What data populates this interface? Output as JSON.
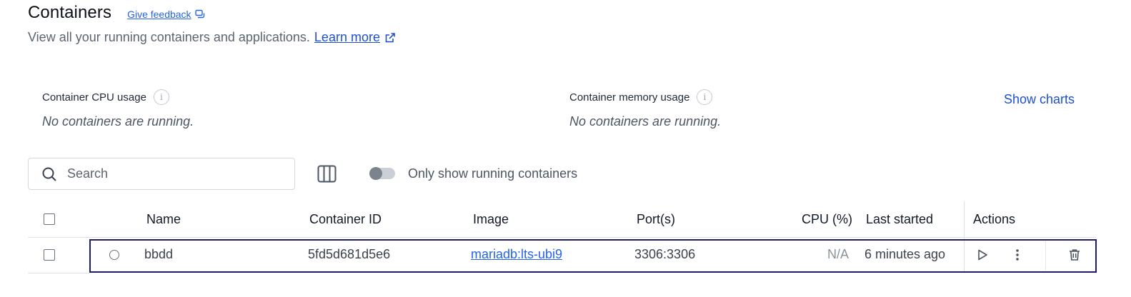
{
  "header": {
    "title": "Containers",
    "feedback_label": "Give feedback",
    "subtitle": "View all your running containers and applications.",
    "learn_more": "Learn more"
  },
  "stats": {
    "cpu_label": "Container CPU usage",
    "cpu_empty": "No containers are running.",
    "memory_label": "Container memory usage",
    "memory_empty": "No containers are running.",
    "show_charts": "Show charts"
  },
  "toolbar": {
    "search_placeholder": "Search",
    "running_toggle_label": "Only show running containers",
    "running_toggle_on": false
  },
  "table": {
    "columns": {
      "name": "Name",
      "container_id": "Container ID",
      "image": "Image",
      "ports": "Port(s)",
      "cpu": "CPU (%)",
      "last_started": "Last started",
      "actions": "Actions"
    },
    "rows": [
      {
        "name": "bbdd",
        "container_id": "5fd5d681d5e6",
        "image": "mariadb:lts-ubi9",
        "ports": "3306:3306",
        "cpu": "N/A",
        "last_started": "6 minutes ago",
        "status": "stopped"
      }
    ]
  },
  "icons": {
    "feedback": "feedback-icon",
    "external_link": "external-link-icon",
    "info": "info-icon",
    "search": "search-icon",
    "columns": "columns-icon",
    "play": "play-icon",
    "more": "more-vertical-icon",
    "delete": "trash-icon"
  },
  "colors": {
    "link": "#2563eb",
    "selected_row_border": "#1e1b6e"
  }
}
